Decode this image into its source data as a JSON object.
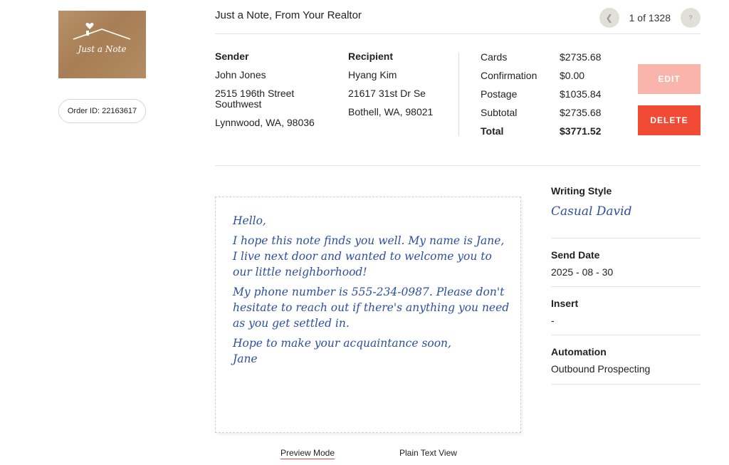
{
  "card": {
    "thumbnail_text": "Just a Note",
    "order_label": "Order ID: 22163617"
  },
  "header": {
    "title": "Just a Note, From Your Realtor",
    "pager": {
      "count": "1 of 1328",
      "prev_icon": "chevron-left-icon",
      "next_icon": "chevron-right-icon",
      "next_glyph": "?"
    }
  },
  "sender": {
    "heading": "Sender",
    "name": "John Jones",
    "street": "2515 196th Street Southwest",
    "city": "Lynnwood, WA, 98036"
  },
  "recipient": {
    "heading": "Recipient",
    "name": "Hyang Kim",
    "street": "21617 31st Dr Se",
    "city": "Bothell, WA, 98021"
  },
  "costs": [
    {
      "label": "Cards",
      "value": "$2735.68"
    },
    {
      "label": "Confirmation",
      "value": "$0.00"
    },
    {
      "label": "Postage",
      "value": "$1035.84"
    },
    {
      "label": "Subtotal",
      "value": "$2735.68"
    },
    {
      "label": "Total",
      "value": "$3771.52"
    }
  ],
  "actions": {
    "edit": "EDIT",
    "delete": "DELETE"
  },
  "note": {
    "p1": "Hello,",
    "p2": "I hope this note finds you well. My name is Jane, I live next door and wanted to welcome you to our little neighborhood!",
    "p3": "My phone number is 555-234-0987. Please don't hesitate to reach out if there's anything you need as you get settled in.",
    "p4a": "Hope to make your acquaintance soon,",
    "p4b": "Jane"
  },
  "view_tabs": {
    "preview": "Preview Mode",
    "plain": "Plain Text View"
  },
  "details": {
    "writing_style_label": "Writing Style",
    "writing_style_value": "Casual David",
    "send_date_label": "Send Date",
    "send_date_value": "2025 - 08 - 30",
    "insert_label": "Insert",
    "insert_value": "-",
    "automation_label": "Automation",
    "automation_value": "Outbound Prospecting"
  },
  "colors": {
    "accent_red": "#f24b35",
    "edit_pink": "#f9b4ac",
    "ink_blue": "#2d4fa0"
  }
}
